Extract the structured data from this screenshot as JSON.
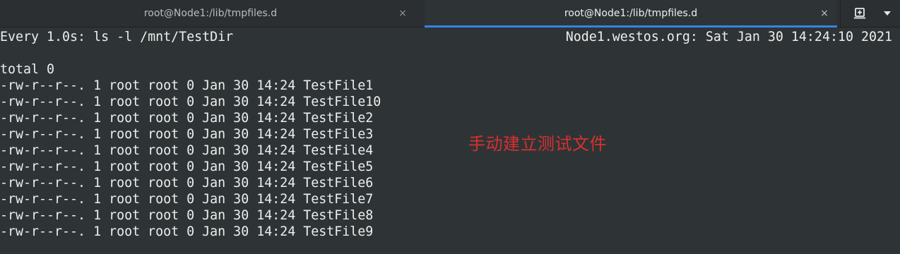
{
  "tabs": [
    {
      "title": "root@Node1:/lib/tmpfiles.d",
      "active": false
    },
    {
      "title": "root@Node1:/lib/tmpfiles.d",
      "active": true
    }
  ],
  "tab_close_glyph": "×",
  "toolbar": {
    "new_tab_icon": "new-tab-icon",
    "menu_icon": "chevron-down-icon"
  },
  "terminal": {
    "header_left": "Every 1.0s: ls -l /mnt/TestDir",
    "header_right": "Node1.westos.org: Sat Jan 30 14:24:10 2021",
    "total": "total 0",
    "files": [
      "-rw-r--r--. 1 root root 0 Jan 30 14:24 TestFile1",
      "-rw-r--r--. 1 root root 0 Jan 30 14:24 TestFile10",
      "-rw-r--r--. 1 root root 0 Jan 30 14:24 TestFile2",
      "-rw-r--r--. 1 root root 0 Jan 30 14:24 TestFile3",
      "-rw-r--r--. 1 root root 0 Jan 30 14:24 TestFile4",
      "-rw-r--r--. 1 root root 0 Jan 30 14:24 TestFile5",
      "-rw-r--r--. 1 root root 0 Jan 30 14:24 TestFile6",
      "-rw-r--r--. 1 root root 0 Jan 30 14:24 TestFile7",
      "-rw-r--r--. 1 root root 0 Jan 30 14:24 TestFile8",
      "-rw-r--r--. 1 root root 0 Jan 30 14:24 TestFile9"
    ]
  },
  "annotation": {
    "text": "手动建立测试文件",
    "color": "#d93030"
  },
  "colors": {
    "background": "#2e3436",
    "foreground": "#eeeeec",
    "accent": "#3584e4"
  }
}
